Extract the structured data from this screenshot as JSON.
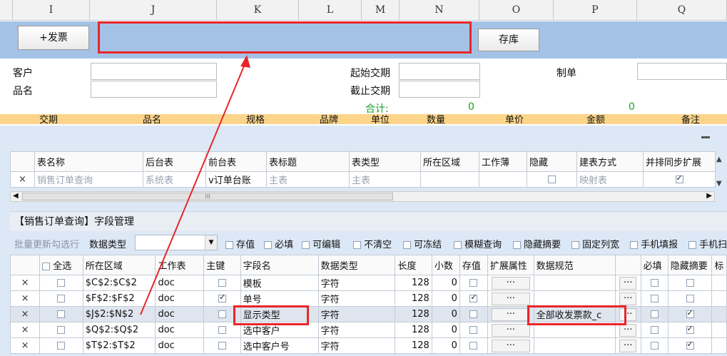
{
  "columns": [
    "I",
    "J",
    "K",
    "L",
    "M",
    "N",
    "O",
    "P",
    "Q"
  ],
  "top_bar": {
    "invoice_button": "+发票",
    "save_button": "存库"
  },
  "form": {
    "customer_label": "客户",
    "product_label": "品名",
    "start_date_label": "起始交期",
    "end_date_label": "截止交期",
    "creator_label": "制单",
    "total_label": "合计:",
    "total_value_1": "0",
    "total_value_2": "0"
  },
  "sum_headers": [
    "交期",
    "品名",
    "规格",
    "品牌",
    "单位",
    "数量",
    "单价",
    "金额",
    "备注"
  ],
  "table_grid": {
    "headers": [
      "表名称",
      "后台表",
      "前台表",
      "表标题",
      "表类型",
      "所在区域",
      "工作薄",
      "隐藏",
      "建表方式",
      "并排同步扩展"
    ],
    "row": {
      "x": "×",
      "name": "销售订单查询",
      "backend": "系统表",
      "frontend": "v订单台账",
      "title": "主表",
      "type": "主表",
      "build": "映射表"
    },
    "hscroll_mark": "III"
  },
  "field_panel": {
    "title": "【销售订单查询】字段管理",
    "batch_label": "批量更新勾选行",
    "data_type_label": "数据类型",
    "toolbar_checks": [
      "存值",
      "必填",
      "可编辑",
      "不清空",
      "可冻结",
      "模糊查询",
      "隐藏摘要",
      "固定列宽",
      "手机填报",
      "手机扫"
    ],
    "headers": [
      "全选",
      "所在区域",
      "工作表",
      "主键",
      "字段名",
      "数据类型",
      "长度",
      "小数",
      "存值",
      "扩展属性",
      "数据规范",
      "必填",
      "隐藏摘要",
      "标"
    ],
    "rows": [
      {
        "x": "×",
        "area": "$C$2:$C$2",
        "sheet": "doc",
        "pk": false,
        "field": "模板",
        "dtype": "字符",
        "len": "128",
        "dec": "0",
        "save": false,
        "spec": "",
        "req": false,
        "hide": false,
        "selected": false
      },
      {
        "x": "×",
        "area": "$F$2:$F$2",
        "sheet": "doc",
        "pk": true,
        "field": "单号",
        "dtype": "字符",
        "len": "128",
        "dec": "0",
        "save": true,
        "spec": "",
        "req": false,
        "hide": false,
        "selected": false
      },
      {
        "x": "×",
        "area": "$J$2:$N$2",
        "sheet": "doc",
        "pk": false,
        "field": "显示类型",
        "dtype": "字符",
        "len": "128",
        "dec": "0",
        "save": false,
        "spec": "全部收发票款_c",
        "req": false,
        "hide": true,
        "selected": true
      },
      {
        "x": "×",
        "area": "$Q$2:$Q$2",
        "sheet": "doc",
        "pk": false,
        "field": "选中客户",
        "dtype": "字符",
        "len": "128",
        "dec": "0",
        "save": false,
        "spec": "",
        "req": false,
        "hide": true,
        "selected": false
      },
      {
        "x": "×",
        "area": "$T$2:$T$2",
        "sheet": "doc",
        "pk": false,
        "field": "选中客户号",
        "dtype": "字符",
        "len": "128",
        "dec": "0",
        "save": false,
        "spec": "",
        "req": false,
        "hide": true,
        "selected": false
      }
    ],
    "ellipsis": "···"
  },
  "colors": {
    "accent_bar": "#a4c2e6",
    "highlight": "#e8262a",
    "sum_row": "#fcd58a",
    "total_green": "#1aa12a"
  }
}
